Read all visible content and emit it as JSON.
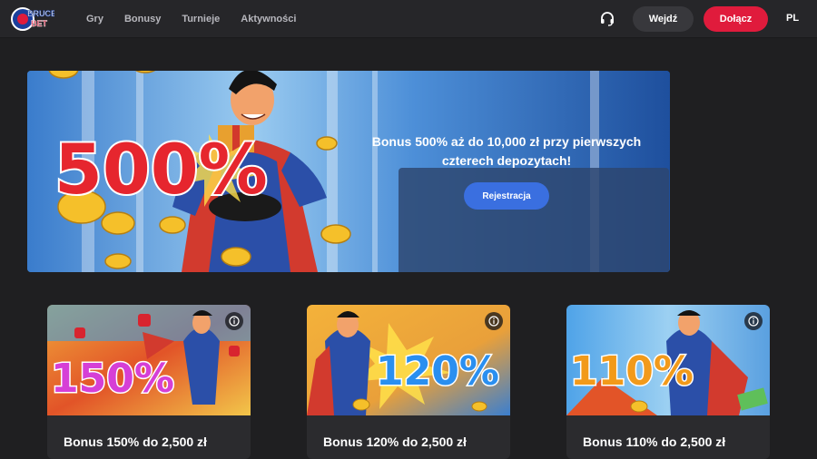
{
  "header": {
    "logo_alt": "BRUCE BET",
    "nav": [
      "Gry",
      "Bonusy",
      "Turnieje",
      "Aktywności"
    ],
    "login_label": "Wejdź",
    "join_label": "Dołącz",
    "language": "PL",
    "colors": {
      "join": "#e01b3c",
      "login": "#38383c"
    }
  },
  "hero": {
    "big_text": "500%",
    "description": "Bonus 500% aż do 10,000 zł przy pierwszych czterech depozytach!",
    "cta_label": "Rejestracja",
    "cta_color": "#3a6fe0"
  },
  "cards": [
    {
      "art_text": "150%",
      "title": "Bonus 150% do 2,500 zł",
      "art_color": "#d63fd6"
    },
    {
      "art_text": "120%",
      "title": "Bonus 120% do 2,500 zł",
      "art_color": "#2a8ff0"
    },
    {
      "art_text": "110%",
      "title": "Bonus 110% do 2,500 zł",
      "art_color": "#f29a1a"
    }
  ]
}
